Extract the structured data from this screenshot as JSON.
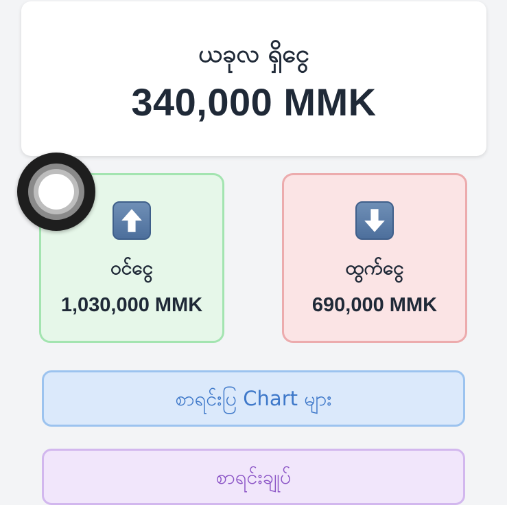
{
  "balance": {
    "title": "ယခုလ ရှိငွေ",
    "amount": "340,000 MMK"
  },
  "income": {
    "icon": "up-arrow-icon",
    "label": "ဝင်ငွေ",
    "value": "1,030,000 MMK"
  },
  "expense": {
    "icon": "down-arrow-icon",
    "label": "ထွက်ငွေ",
    "value": "690,000 MMK"
  },
  "buttons": {
    "chart_label": "စာရင်းပြ Chart များ",
    "summary_label": "စာရင်းချုပ်"
  },
  "colors": {
    "income_bg": "#e6f7e9",
    "expense_bg": "#fbe4e5",
    "chart_button_text": "#3e78c9",
    "summary_button_text": "#8b54c6"
  }
}
